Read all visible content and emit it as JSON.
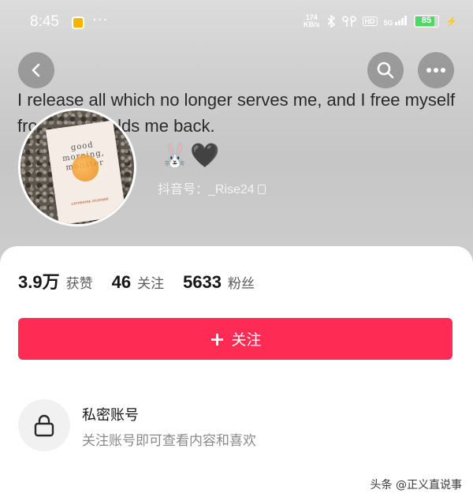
{
  "status_bar": {
    "time": "8:45",
    "more_dots": "···",
    "net_speed_value": "174",
    "net_speed_unit": "KB/s",
    "hd_label": "HD",
    "signal_label": "5G",
    "battery_level": "85",
    "battery_percent": 85
  },
  "profile": {
    "bio": "I release all which no longer serves me, and I free myself from what holds me back.",
    "book_title": "good morning, monster",
    "book_author": "CATHERINE GILDINER",
    "emoji_rabbit": "🐰",
    "emoji_heart": "🖤",
    "douyin_id": "抖音号：_Rise24"
  },
  "stats": [
    {
      "value": "3.9万",
      "label": "获赞"
    },
    {
      "value": "46",
      "label": "关注"
    },
    {
      "value": "5633",
      "label": "粉丝"
    }
  ],
  "follow_button": {
    "plus": "+",
    "label": "关注"
  },
  "private": {
    "title": "私密账号",
    "description": "关注账号即可查看内容和喜欢"
  },
  "watermark": {
    "text": "头条 @正义直说事"
  },
  "colors": {
    "accent": "#fe2c55"
  }
}
